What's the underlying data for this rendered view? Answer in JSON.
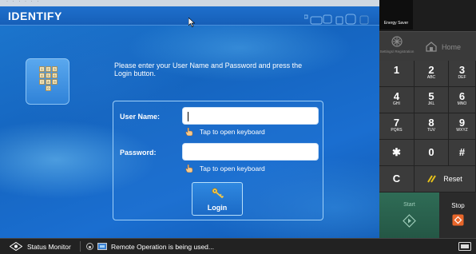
{
  "window": {
    "title": "IDENTIFY",
    "top_strip_text": "· ·  ·   ·  · ·"
  },
  "instruction_text": "Please enter your User Name and Password and press the Login button.",
  "login": {
    "username_label": "User Name:",
    "username_value": "",
    "password_label": "Password:",
    "password_value": "",
    "tap_keyboard_text": "Tap to open keyboard",
    "login_button_label": "Login"
  },
  "keypad_icon_digits": [
    "1",
    "2",
    "3",
    "4",
    "5",
    "6",
    "7",
    "8",
    "9",
    "0"
  ],
  "right_panel": {
    "energy_saver_label": "Energy Saver",
    "settings_label": "Settings/ Registration",
    "home_label": "Home",
    "keys": [
      {
        "digit": "1",
        "letters": ""
      },
      {
        "digit": "2",
        "letters": "ABC"
      },
      {
        "digit": "3",
        "letters": "DEF"
      },
      {
        "digit": "4",
        "letters": "GHI"
      },
      {
        "digit": "5",
        "letters": "JKL"
      },
      {
        "digit": "6",
        "letters": "MNO"
      },
      {
        "digit": "7",
        "letters": "PQRS"
      },
      {
        "digit": "8",
        "letters": "TUV"
      },
      {
        "digit": "9",
        "letters": "WXYZ"
      },
      {
        "digit": "✱",
        "letters": ""
      },
      {
        "digit": "0",
        "letters": ""
      },
      {
        "digit": "#",
        "letters": ""
      }
    ],
    "clear_label": "C",
    "reset_label": "Reset",
    "start_label": "Start",
    "stop_label": "Stop"
  },
  "status_bar": {
    "status_monitor_label": "Status Monitor",
    "remote_operation_text": "Remote Operation is being used..."
  },
  "colors": {
    "screen_blue": "#1565c0",
    "start_green": "#2f6c56",
    "stop_orange": "#e8662a"
  }
}
